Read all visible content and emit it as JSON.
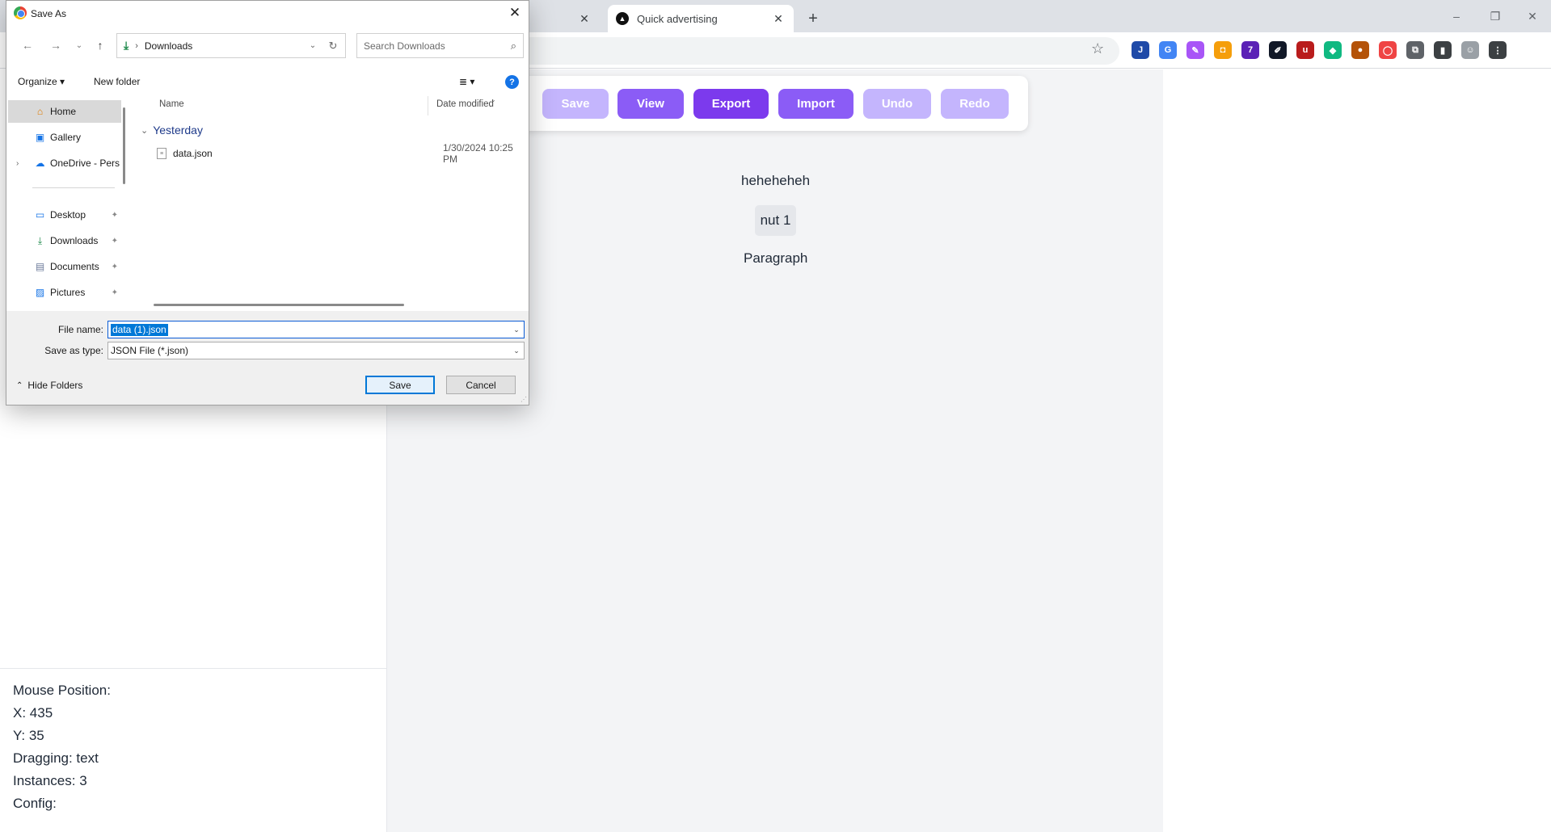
{
  "browser": {
    "tabs": [
      {
        "title": ""
      },
      {
        "title": "Quick advertising",
        "active": true
      }
    ],
    "new_tab_label": "+",
    "window_controls": [
      "–",
      "❐",
      "✕"
    ],
    "extension_icons": [
      {
        "name": "extension-j-icon",
        "label": "J",
        "color": "#1f4aa8"
      },
      {
        "name": "translate-icon",
        "label": "G",
        "color": "#4285f4"
      },
      {
        "name": "pen-icon",
        "label": "✎",
        "color": "#a855f7"
      },
      {
        "name": "extension-orange-icon",
        "label": "◘",
        "color": "#f59e0b"
      },
      {
        "name": "extension-badge-icon",
        "label": "7",
        "color": "#5b21b6"
      },
      {
        "name": "eyedropper-icon",
        "label": "✐",
        "color": "#111827"
      },
      {
        "name": "ublock-icon",
        "label": "u",
        "color": "#b91c1c"
      },
      {
        "name": "extension-teal-icon",
        "label": "◆",
        "color": "#10b981"
      },
      {
        "name": "cookie-icon",
        "label": "●",
        "color": "#b45309"
      },
      {
        "name": "extension-red-icon",
        "label": "◯",
        "color": "#ef4444"
      },
      {
        "name": "puzzle-icon",
        "label": "⧉",
        "color": "#5f6368"
      },
      {
        "name": "sidebar-icon",
        "label": "▮",
        "color": "#3c4043"
      },
      {
        "name": "profile-icon",
        "label": "☺",
        "color": "#9aa0a6"
      },
      {
        "name": "menu-icon",
        "label": "⋮",
        "color": "#3c4043"
      }
    ]
  },
  "editor": {
    "toolbar": {
      "save": "Save",
      "view": "View",
      "export": "Export",
      "import": "Import",
      "undo": "Undo",
      "redo": "Redo"
    },
    "canvas": {
      "heading": "heheheheh",
      "button": "nut 1",
      "paragraph": "Paragraph"
    },
    "info": {
      "mouse_position": "Mouse Position:",
      "x": "X: 435",
      "y": "Y: 35",
      "dragging": "Dragging: text",
      "instances": "Instances: 3",
      "config": "Config:"
    }
  },
  "dialog": {
    "title": "Save As",
    "address": {
      "location": "Downloads"
    },
    "search_placeholder": "Search Downloads",
    "commands": {
      "organize": "Organize ▾",
      "new_folder": "New folder",
      "view_icon": "≣ ▾"
    },
    "nav_items": [
      {
        "label": "Home",
        "icon": "⌂",
        "selected": true
      },
      {
        "label": "Gallery",
        "icon": "▣"
      },
      {
        "label": "OneDrive - Personal",
        "icon": "☁"
      },
      {
        "label": "Desktop",
        "icon": "▭",
        "pinned": true
      },
      {
        "label": "Downloads",
        "icon": "⤓",
        "pinned": true
      },
      {
        "label": "Documents",
        "icon": "▤",
        "pinned": true
      },
      {
        "label": "Pictures",
        "icon": "▨",
        "pinned": true
      }
    ],
    "columns": {
      "name": "Name",
      "date_modified": "Date modified"
    },
    "group": "Yesterday",
    "files": [
      {
        "name": "data.json",
        "date": "1/30/2024 10:25 PM"
      }
    ],
    "file_name_label": "File name:",
    "file_name_value": "data (1).json",
    "save_as_type_label": "Save as type:",
    "save_as_type_value": "JSON File (*.json)",
    "hide_folders": "Hide Folders",
    "save_button": "Save",
    "cancel_button": "Cancel"
  }
}
